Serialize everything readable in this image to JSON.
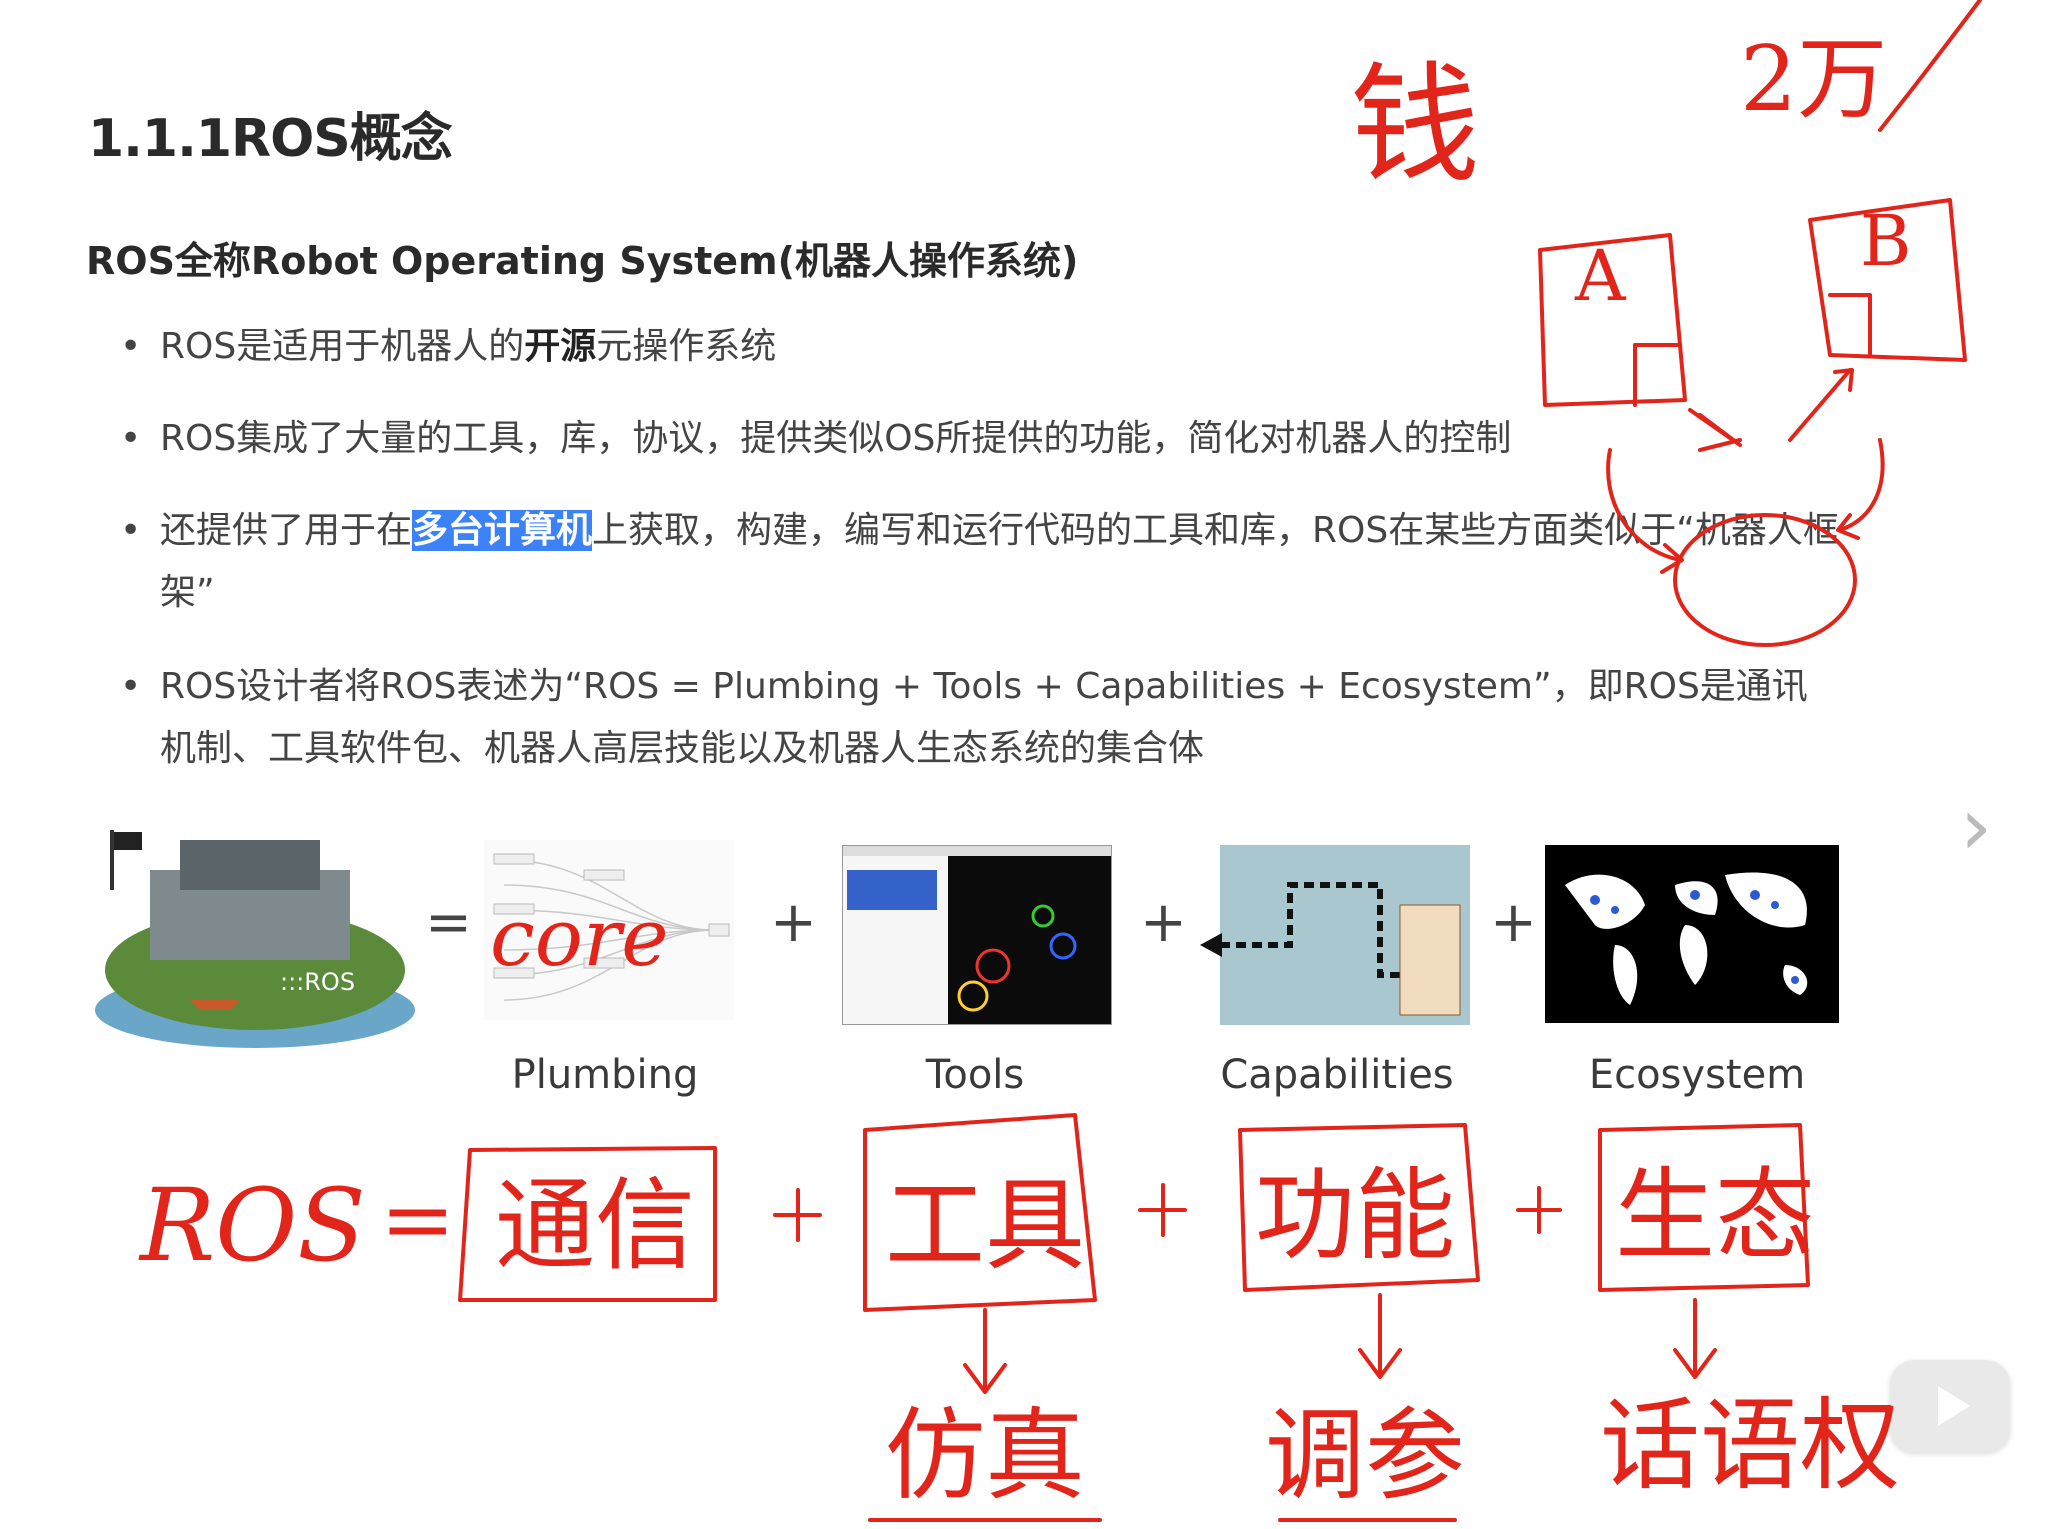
{
  "heading": "1.1.1ROS概念",
  "subtitle": "ROS全称Robot Operating System(机器人操作系统)",
  "bullets": [
    {
      "pre": "ROS是适用于机器人的",
      "strong": "开源",
      "post": "元操作系统"
    },
    {
      "text": "ROS集成了大量的工具，库，协议，提供类似OS所提供的功能，简化对机器人的控制"
    },
    {
      "pre": "还提供了用于在",
      "highlight": "多台计算机",
      "post": "上获取，构建，编写和运行代码的工具和库，ROS在某些方面类似于“机器人框架”"
    },
    {
      "text": "ROS设计者将ROS表述为“ROS = Plumbing + Tools + Capabilities + Ecosystem”，即ROS是通讯机制、工具软件包、机器人高层技能以及机器人生态系统的集合体"
    }
  ],
  "diagram": {
    "equals": "=",
    "plus": "+",
    "logo_text": ":::ROS",
    "labels": [
      "Plumbing",
      "Tools",
      "Capabilities",
      "Ecosystem"
    ]
  },
  "annotations": {
    "core": "core",
    "money": "钱",
    "amount": "2万",
    "node_a": "A",
    "node_b": "B",
    "ros": "ROS",
    "eq": "=",
    "terms": [
      "通信",
      "工具",
      "功能",
      "生态"
    ],
    "subterms": [
      "仿真",
      "调参",
      "话语权"
    ],
    "ink_color": "#e1251b"
  },
  "colors": {
    "highlight": "#3b82f6",
    "ink": "#e1251b"
  },
  "icons": {
    "next": "chevron-right-icon",
    "play": "play-icon"
  }
}
